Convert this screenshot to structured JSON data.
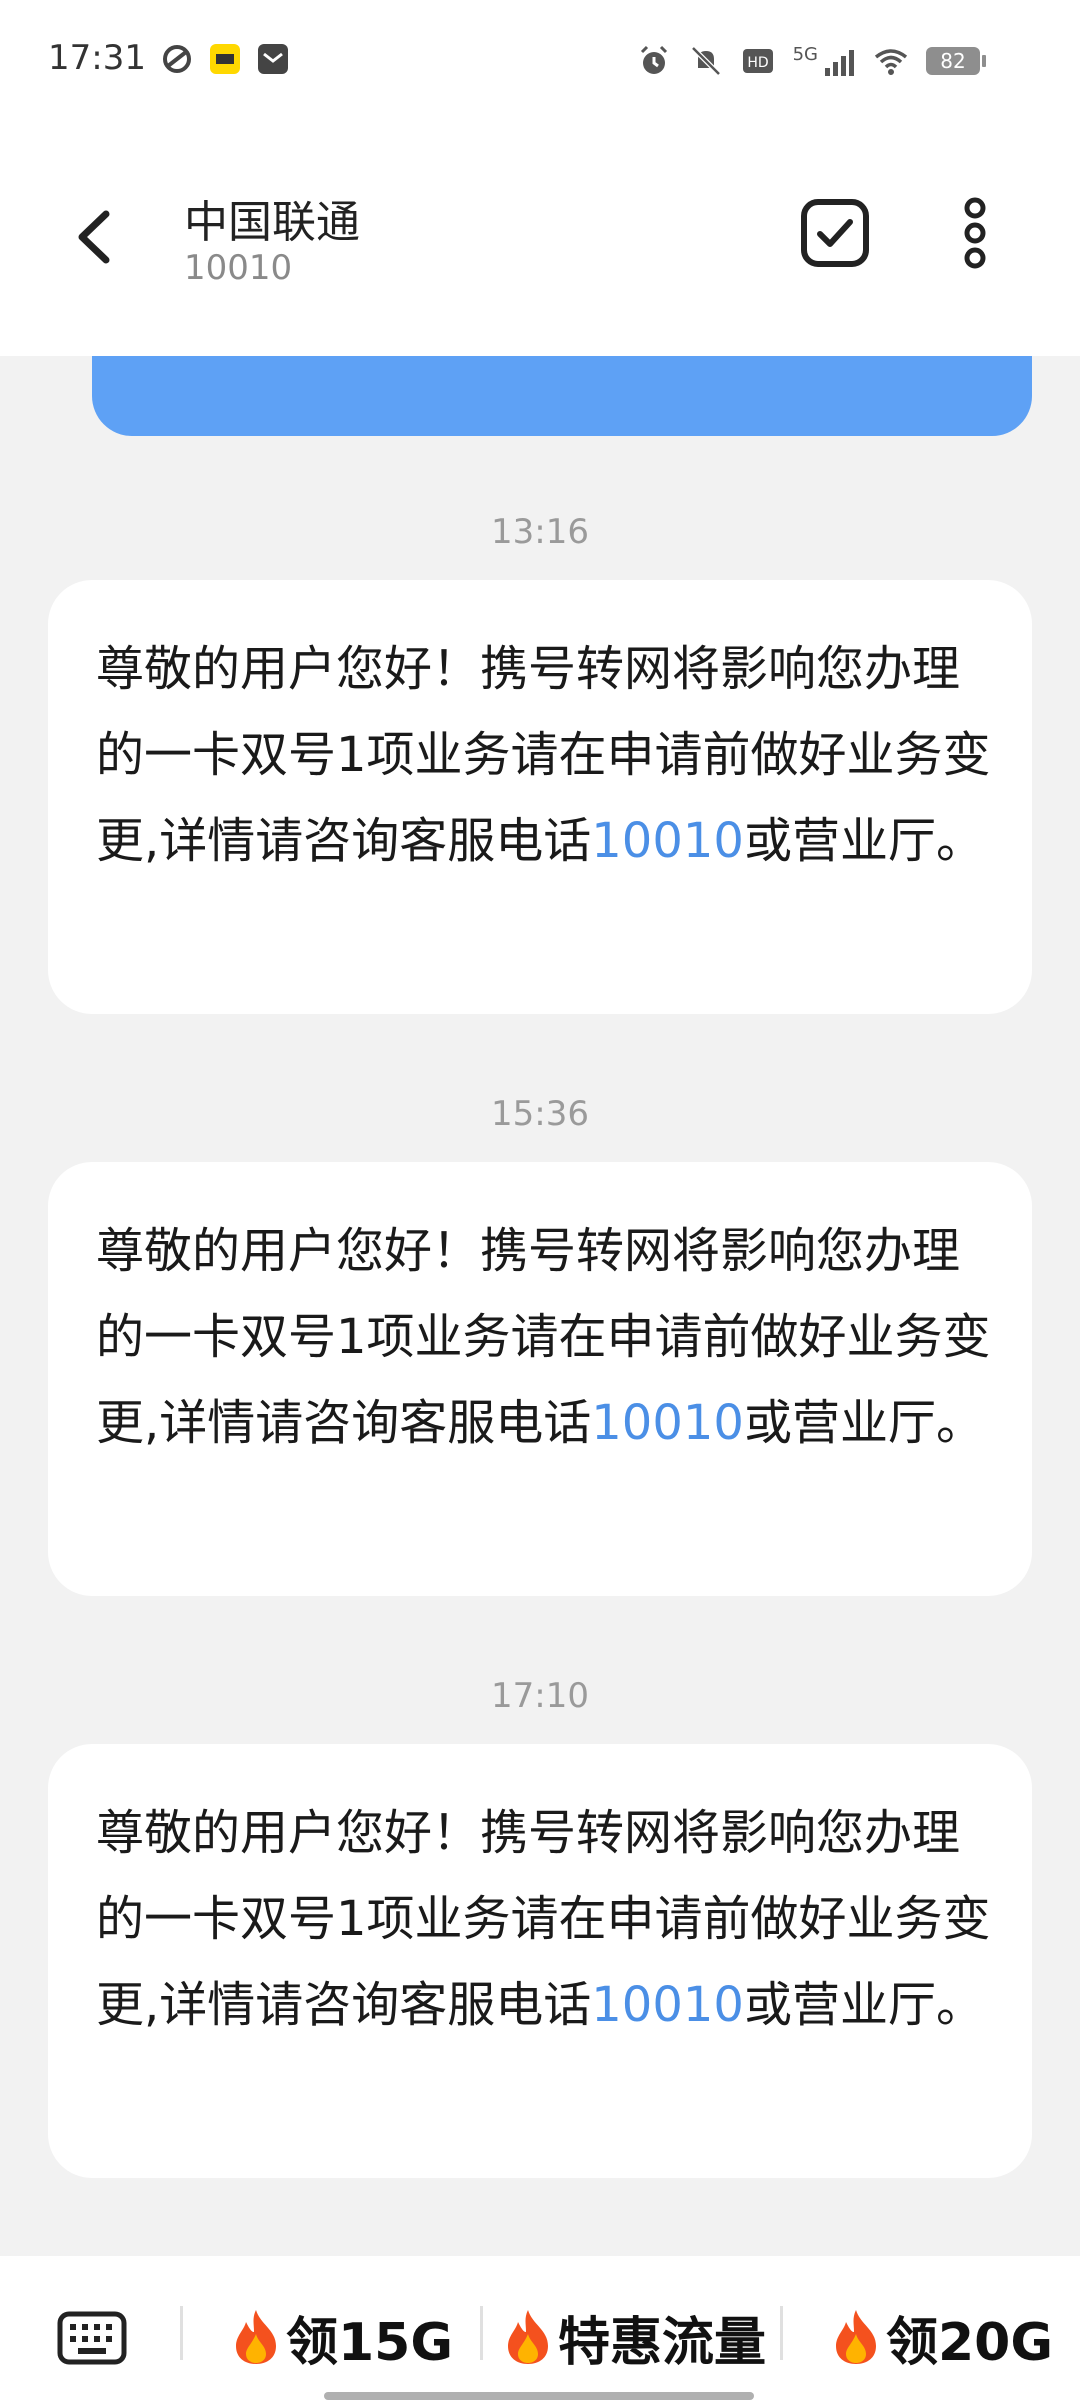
{
  "status_bar": {
    "time": "17:31",
    "network": "5G",
    "battery": "82"
  },
  "header": {
    "title": "中国联通",
    "subtitle": "10010"
  },
  "messages": [
    {
      "time": "13:16",
      "text": "尊敬的用户您好！携号转网将影响您办理的一卡双号1项业务请在申请前做好业务变更,详情请咨询客服电话",
      "link": "10010",
      "tail": "或营业厅。"
    },
    {
      "time": "15:36",
      "text": "尊敬的用户您好！携号转网将影响您办理的一卡双号1项业务请在申请前做好业务变更,详情请咨询客服电话",
      "link": "10010",
      "tail": "或营业厅。"
    },
    {
      "time": "17:10",
      "text": "尊敬的用户您好！携号转网将影响您办理的一卡双号1项业务请在申请前做好业务变更,详情请咨询客服电话",
      "link": "10010",
      "tail": "或营业厅。"
    }
  ],
  "quick_replies": [
    {
      "label": "领15G",
      "icon": "fire-icon"
    },
    {
      "label": "特惠流量",
      "icon": "fire-icon"
    },
    {
      "label": "领20G",
      "icon": "fire-icon"
    }
  ],
  "colors": {
    "sent_bubble": "#5ea1f5",
    "link": "#4b8fe6",
    "background": "#f2f2f2"
  }
}
